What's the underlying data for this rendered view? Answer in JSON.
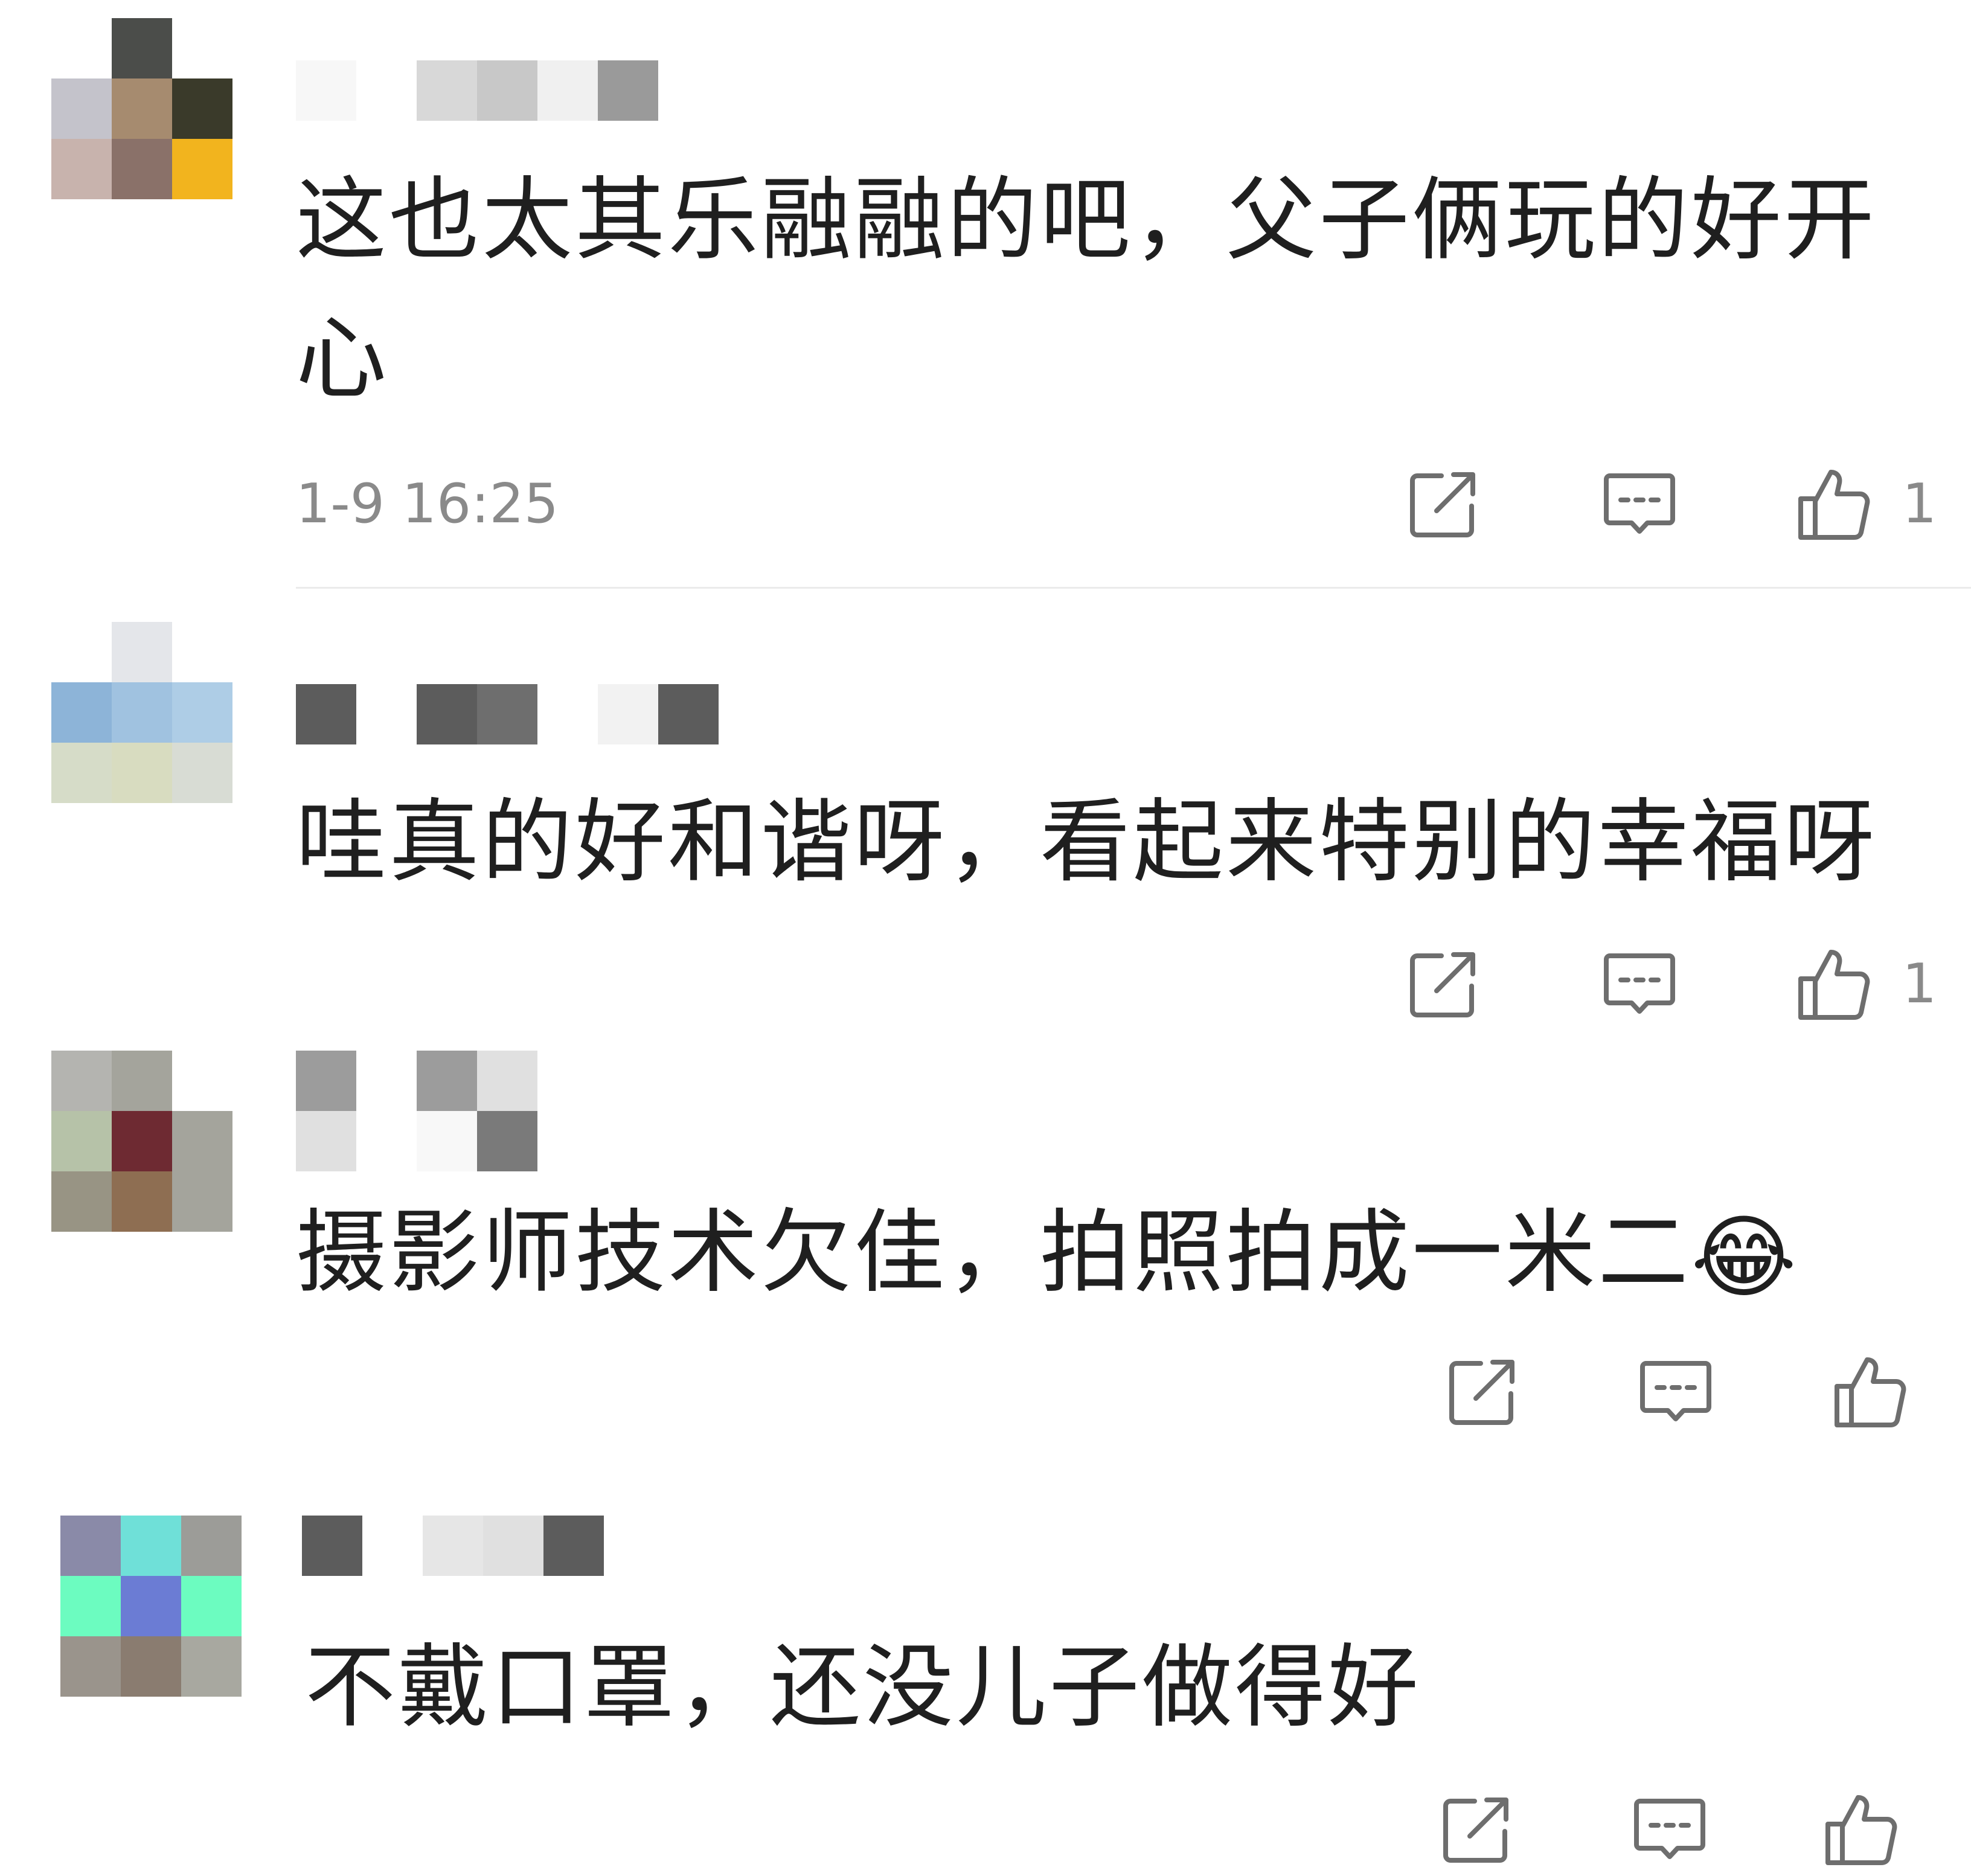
{
  "comments": [
    {
      "text": "这也太其乐融融的吧，父子俩玩的好开心",
      "time": "1-9 16:25",
      "like_count": "1",
      "avatar_colors": [
        "#ffffff",
        "#4b4d4a",
        "#ffffff",
        "#c4c3cb",
        "#a68b6f",
        "#3a3a2a",
        "#c8b3ad",
        "#8a7169",
        "#f2b41e"
      ]
    },
    {
      "text": "哇真的好和谐呀，看起来特别的幸福呀",
      "time": "",
      "like_count": "1",
      "avatar_colors": [
        "#ffffff",
        "#e4e6ea",
        "#ffffff",
        "#8db4d8",
        "#a0c2e0",
        "#aecde6",
        "#d6dcc8",
        "#d8dcc0",
        "#d8dcd4"
      ]
    },
    {
      "text": "摄影师技术欠佳，拍照拍成一米二",
      "emoji": "😂",
      "time": "",
      "like_count": "",
      "avatar_colors": [
        "#b4b4b0",
        "#a4a49c",
        "#ffffff",
        "#b6c2a8",
        "#6e2a32",
        "#a4a49c",
        "#989484",
        "#8e6e52",
        "#a4a49c"
      ]
    },
    {
      "text": "不戴口罩，还没儿子做得好",
      "time": "",
      "like_count": "",
      "avatar_colors": [
        "#8a8aa8",
        "#6fe0d8",
        "#9c9c98",
        "#6cfcc0",
        "#6b7cd4",
        "#6cfcc0",
        "#9a948c",
        "#8a7c70",
        "#a8a8a0"
      ]
    }
  ],
  "icons": {
    "share": "share-icon",
    "reply": "reply-icon",
    "like": "like-icon"
  },
  "colors": {
    "text": "#1f1f1f",
    "meta": "#8a8a8a",
    "icon": "#6e6e6e",
    "divider": "#ebebeb"
  }
}
